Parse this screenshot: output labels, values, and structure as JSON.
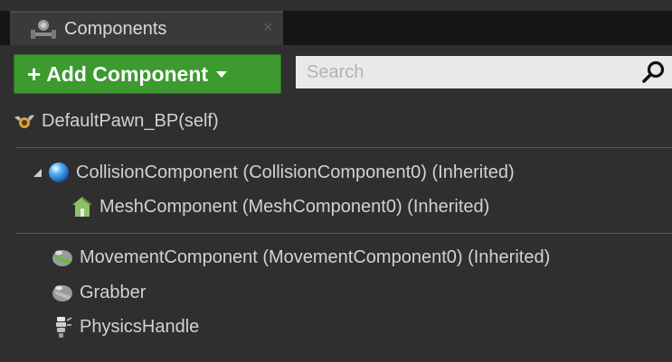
{
  "panel": {
    "tab_label": "Components",
    "tab_close": "×",
    "tab_icon": "components-icon"
  },
  "toolbar": {
    "add_plus": "+",
    "add_label": "Add Component",
    "add_caret_icon": "chevron-down-icon",
    "search_placeholder": "Search",
    "search_icon": "search-icon"
  },
  "tree": {
    "root": {
      "label": "DefaultPawn_BP(self)",
      "icon": "pawn-icon"
    },
    "collision": {
      "label": "CollisionComponent (CollisionComponent0) (Inherited)",
      "icon": "sphere-icon",
      "expander": "expanded-triangle-icon"
    },
    "mesh": {
      "label": "MeshComponent (MeshComponent0) (Inherited)",
      "icon": "static-mesh-icon"
    },
    "movement": {
      "label": "MovementComponent (MovementComponent0) (Inherited)",
      "icon": "actor-component-icon"
    },
    "grabber": {
      "label": "Grabber",
      "icon": "actor-component-icon"
    },
    "physics": {
      "label": "PhysicsHandle",
      "icon": "physics-handle-icon"
    }
  },
  "colors": {
    "add_button": "#3c9a2f",
    "panel_bg": "#2f2f2f",
    "tabbar_bg": "#151515"
  }
}
